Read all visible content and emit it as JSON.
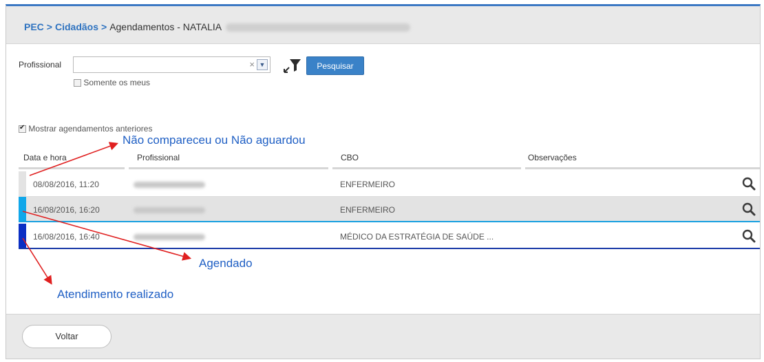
{
  "breadcrumb": {
    "root": "PEC",
    "separator": ">",
    "section": "Cidadãos",
    "page": "Agendamentos - NATALIA"
  },
  "filters": {
    "professional_label": "Profissional",
    "professional_value": "",
    "clear_glyph": "×",
    "dropdown_glyph": "▼",
    "search_button": "Pesquisar",
    "only_mine_label": "Somente os meus",
    "only_mine_checked": false,
    "show_previous_label": "Mostrar agendamentos anteriores",
    "show_previous_checked": true
  },
  "table": {
    "columns": [
      "Data e hora",
      "Profissional",
      "CBO",
      "Observações"
    ],
    "rows": [
      {
        "datetime": "08/08/2016, 11:20",
        "cbo": "ENFERMEIRO",
        "observations": "",
        "status": "Não compareceu ou Não aguardou",
        "status_color": "#e3e3e3",
        "highlighted": false
      },
      {
        "datetime": "16/08/2016, 16:20",
        "cbo": "ENFERMEIRO",
        "observations": "",
        "status": "Agendado",
        "status_color": "#10a7ea",
        "highlighted": true
      },
      {
        "datetime": "16/08/2016, 16:40",
        "cbo": "MÉDICO DA ESTRATÉGIA DE SAÚDE ...",
        "observations": "",
        "status": "Atendimento realizado",
        "status_color": "#0b2fc4",
        "highlighted": false
      }
    ]
  },
  "annotations": {
    "no_show": "Não compareceu ou Não aguardou",
    "scheduled": "Agendado",
    "done": "Atendimento realizado",
    "color": "#1f5fc4",
    "arrow_color": "#e02020"
  },
  "footer": {
    "back_button": "Voltar"
  },
  "colors": {
    "accent": "#3b78c3",
    "link": "#2f73c0",
    "button": "#3a82c8",
    "highlight_row": "#e3e3e3"
  }
}
